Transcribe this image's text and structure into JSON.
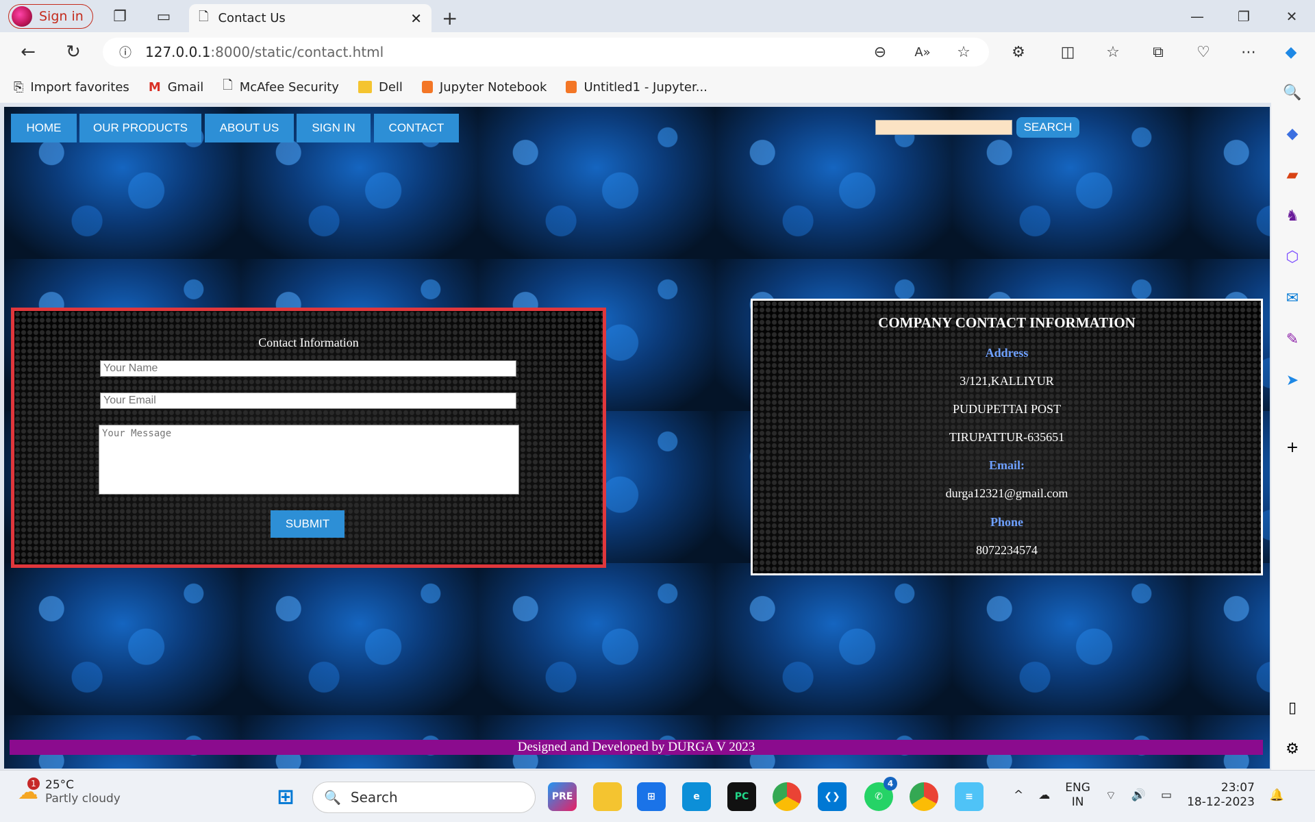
{
  "browser": {
    "profile_label": "Sign in",
    "tab_title": "Contact Us",
    "url_host": "127.0.0.1",
    "url_path": ":8000/static/contact.html",
    "favorites": [
      "Import favorites",
      "Gmail",
      "McAfee Security",
      "Dell",
      "Jupyter Notebook",
      "Untitled1 - Jupyter..."
    ]
  },
  "nav": {
    "items": [
      "HOME",
      "OUR PRODUCTS",
      "ABOUT US",
      "SIGN IN",
      "CONTACT"
    ],
    "search_button": "SEARCH"
  },
  "form": {
    "title": "Contact Information",
    "name_placeholder": "Your Name",
    "email_placeholder": "Your Email",
    "message_placeholder": "Your Message",
    "submit_label": "SUBMIT"
  },
  "company": {
    "title": "COMPANY CONTACT INFORMATION",
    "address_label": "Address",
    "address_lines": [
      "3/121,KALLIYUR",
      "PUDUPETTAI POST",
      "TIRUPATTUR-635651"
    ],
    "email_label": "Email:",
    "email": "durga12321@gmail.com",
    "phone_label": "Phone",
    "phone": "8072234574"
  },
  "footer": {
    "text": "Designed and Developed by DURGA V 2023"
  },
  "taskbar": {
    "weather_temp": "25°C",
    "weather_desc": "Partly cloudy",
    "weather_badge": "1",
    "search_label": "Search",
    "whatsapp_badge": "4",
    "lang": "ENG",
    "region": "IN",
    "time": "23:07",
    "date": "18-12-2023"
  },
  "colors": {
    "nav_blue": "#2d8fd6",
    "form_border": "#e0373c",
    "footer_purple": "#8b0b8e",
    "label_blue": "#6ea0ff"
  }
}
